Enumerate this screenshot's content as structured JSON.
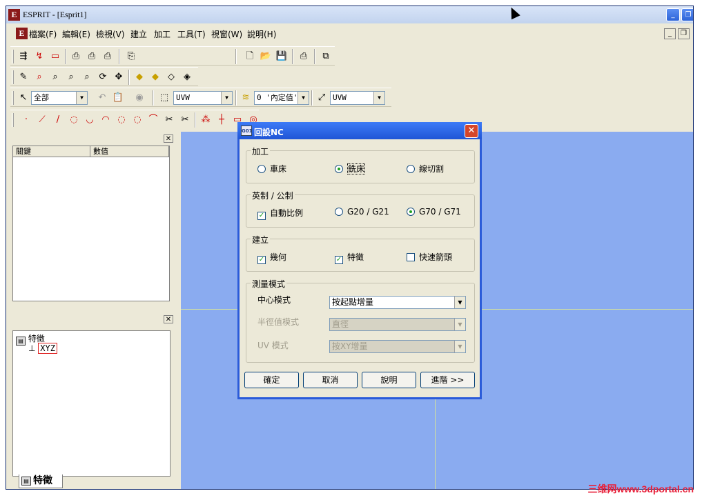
{
  "window": {
    "title": "ESPRIT - [Esprit1]",
    "logo": "E"
  },
  "menu": [
    {
      "label": "檔案(F)"
    },
    {
      "label": "編輯(E)"
    },
    {
      "label": "檢視(V)"
    },
    {
      "label": "建立"
    },
    {
      "label": "加工"
    },
    {
      "label": "工具(T)"
    },
    {
      "label": "視窗(W)"
    },
    {
      "label": "說明(H)"
    }
  ],
  "toolbar": {
    "select_combo": "全部",
    "plane_combo": "UVW",
    "layer_combo": "0 '內定值'",
    "workplane_combo": "UVW"
  },
  "properties_panel": {
    "col_key": "關鍵",
    "col_value": "數值"
  },
  "tree": {
    "root": "特徵",
    "child": "XYZ"
  },
  "left_tab": "特徵",
  "dialog": {
    "title": "回設NC",
    "group_machining": {
      "label": "加工",
      "options": [
        {
          "label": "車床",
          "selected": false
        },
        {
          "label": "銑床",
          "selected": true
        },
        {
          "label": "線切割",
          "selected": false
        }
      ]
    },
    "group_units": {
      "label": "英制 / 公制",
      "auto_scale": {
        "label": "自動比例",
        "checked": true
      },
      "options": [
        {
          "label": "G20 / G21",
          "selected": false
        },
        {
          "label": "G70 / G71",
          "selected": true
        }
      ]
    },
    "group_create": {
      "label": "建立",
      "items": [
        {
          "label": "幾何",
          "checked": true
        },
        {
          "label": "特徵",
          "checked": true
        },
        {
          "label": "快速箭頭",
          "checked": false
        }
      ]
    },
    "group_measure": {
      "label": "測量模式",
      "center_mode": {
        "label": "中心模式",
        "value": "按起點增量"
      },
      "radius_mode": {
        "label": "半徑值模式",
        "value": "直徑"
      },
      "uv_mode": {
        "label": "UV 模式",
        "value": "按XY增量"
      }
    },
    "buttons": {
      "ok": "確定",
      "cancel": "取消",
      "help": "說明",
      "advanced": "進階 >>"
    }
  },
  "watermark": "三维网www.3dportal.cn"
}
